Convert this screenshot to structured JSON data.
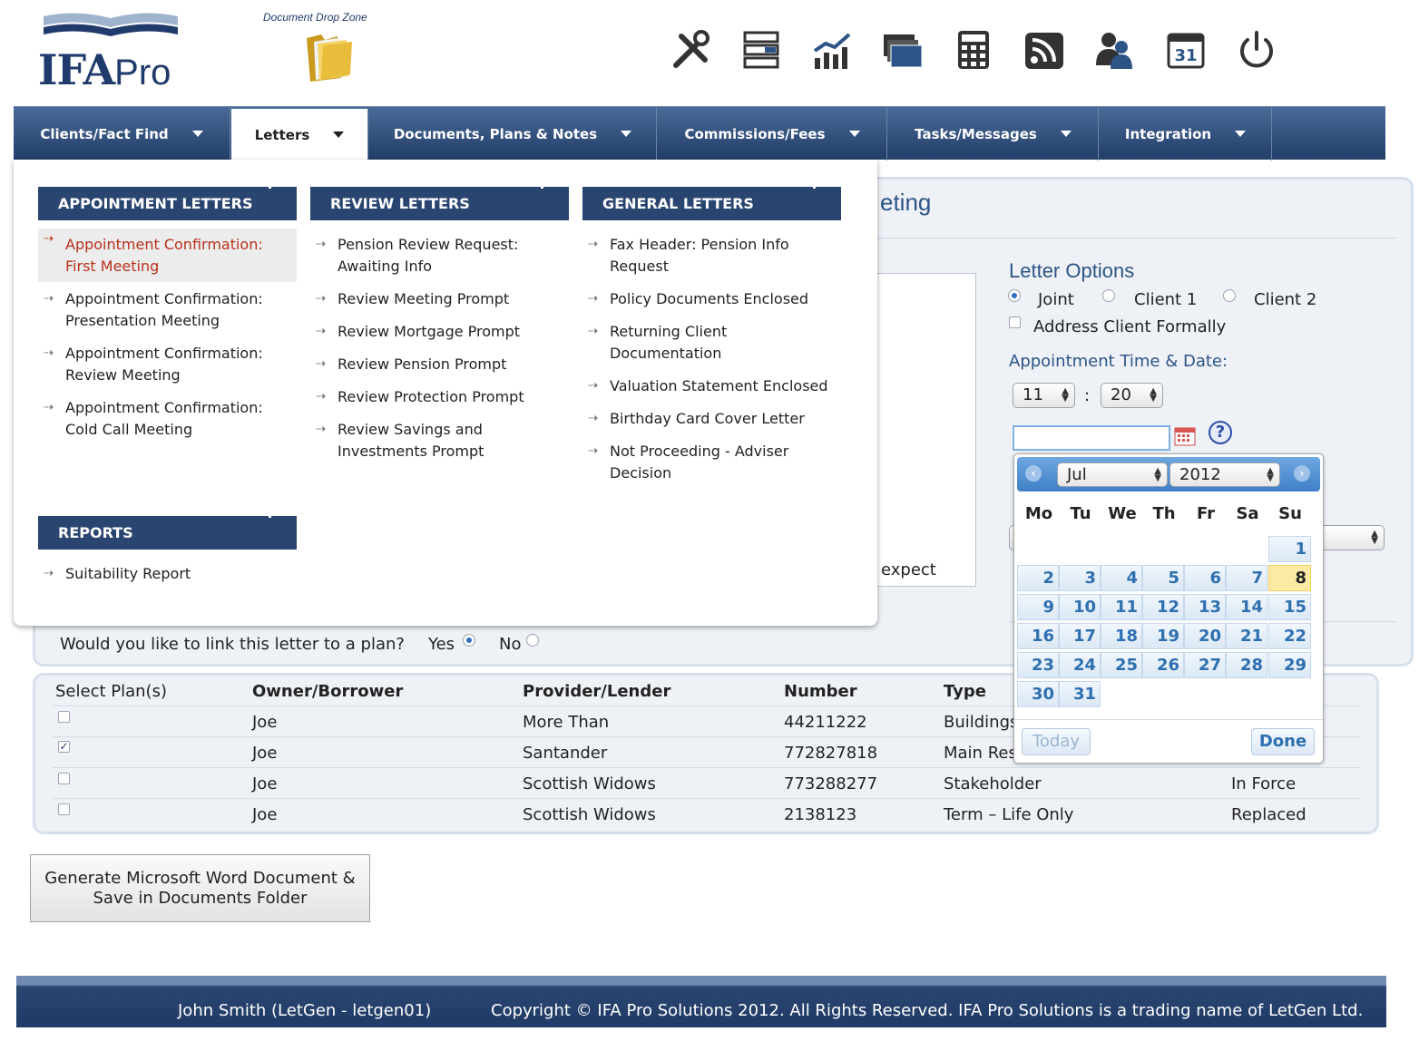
{
  "header": {
    "logo_text": "IFA",
    "logo_suffix": "Pro",
    "drop_zone_label": "Document Drop Zone",
    "toolbar_icons": [
      "tools-icon",
      "layers-icon",
      "chart-icon",
      "money-icon",
      "calculator-icon",
      "rss-icon",
      "users-icon",
      "calendar-icon",
      "power-icon"
    ]
  },
  "nav": {
    "items": [
      {
        "label": "Clients/Fact Find"
      },
      {
        "label": "Letters"
      },
      {
        "label": "Documents, Plans & Notes"
      },
      {
        "label": "Commissions/Fees"
      },
      {
        "label": "Tasks/Messages"
      },
      {
        "label": "Integration"
      }
    ],
    "active": "Letters"
  },
  "menu": {
    "appointment": {
      "title": "APPOINTMENT LETTERS",
      "items": [
        "Appointment Confirmation: First Meeting",
        "Appointment Confirmation: Presentation Meeting",
        "Appointment Confirmation: Review Meeting",
        "Appointment Confirmation: Cold Call Meeting"
      ]
    },
    "review": {
      "title": "REVIEW LETTERS",
      "items": [
        "Pension Review Request: Awaiting Info",
        "Review Meeting Prompt",
        "Review Mortgage Prompt",
        "Review Pension Prompt",
        "Review Protection Prompt",
        "Review Savings and Investments Prompt"
      ]
    },
    "general": {
      "title": "GENERAL LETTERS",
      "items": [
        "Fax Header: Pension Info Request",
        "Policy Documents Enclosed",
        "Returning Client Documentation",
        "Valuation Statement Enclosed",
        "Birthday Card Cover Letter",
        "Not Proceeding - Adviser Decision"
      ]
    },
    "reports": {
      "title": "REPORTS",
      "items": [
        "Suitability Report"
      ]
    }
  },
  "main": {
    "title_fragment": "eting",
    "textarea_fragment": "expect",
    "letter_options": {
      "title": "Letter Options",
      "joint": "Joint",
      "client1": "Client 1",
      "client2": "Client 2",
      "formal": "Address Client Formally",
      "selected": "Joint"
    },
    "appointment": {
      "label": "Appointment Time & Date:",
      "hour": "11",
      "separator": ":",
      "minute": "20",
      "date_value": ""
    },
    "link_question": "Would you like to link this letter to a plan?",
    "yes": "Yes",
    "no": "No",
    "link_selected": "Yes"
  },
  "plans": {
    "headers": [
      "Select Plan(s)",
      "Owner/Borrower",
      "Provider/Lender",
      "Number",
      "Type"
    ],
    "rows": [
      {
        "checked": false,
        "owner": "Joe",
        "provider": "More Than",
        "number": "44211222",
        "type": "Buildings",
        "status": ""
      },
      {
        "checked": true,
        "owner": "Joe",
        "provider": "Santander",
        "number": "772827818",
        "type": "Main Res",
        "status": ""
      },
      {
        "checked": false,
        "owner": "Joe",
        "provider": "Scottish Widows",
        "number": "773288277",
        "type": "Stakeholder",
        "status": "In Force"
      },
      {
        "checked": false,
        "owner": "Joe",
        "provider": "Scottish Widows",
        "number": "2138123",
        "type": "Term – Life Only",
        "status": "Replaced"
      }
    ]
  },
  "generate_button": {
    "line1": "Generate Microsoft Word Document &",
    "line2": "Save in Documents Folder"
  },
  "datepicker": {
    "month": "Jul",
    "year": "2012",
    "weekdays": [
      "Mo",
      "Tu",
      "We",
      "Th",
      "Fr",
      "Sa",
      "Su"
    ],
    "first_weekday_index": 6,
    "days_in_month": 31,
    "today": 8,
    "today_label": "Today",
    "done_label": "Done",
    "prev": "‹",
    "next": "›"
  },
  "footer": {
    "user": "John Smith (LetGen - letgen01)",
    "copyright": "Copyright © IFA Pro Solutions 2012. All Rights Reserved. IFA Pro Solutions is a trading name of LetGen Ltd."
  },
  "colors": {
    "navy": "#1f3a6b",
    "nav_bar": "#2a4670",
    "link_blue": "#2d5486",
    "highlight_red": "#b9301c",
    "calendar_today": "#fbe9a4"
  }
}
